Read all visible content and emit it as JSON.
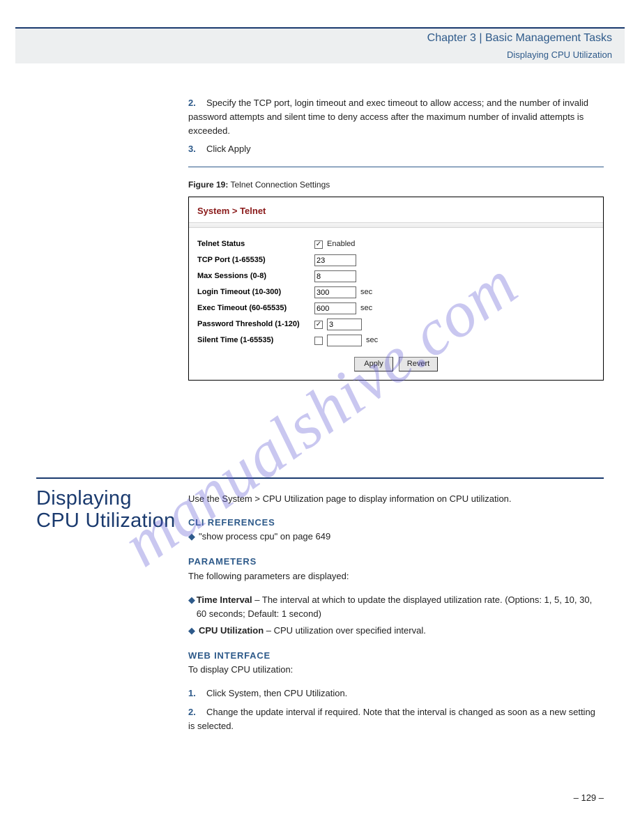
{
  "header": {
    "chapter": "Chapter 3  |  Basic Management Tasks",
    "section": "Displaying CPU Utilization"
  },
  "steps": {
    "s2": "Specify the TCP port, login timeout and exec timeout to allow access; and the number of invalid password attempts and silent time to deny access after the maximum number of invalid attempts is exceeded.",
    "s3": "Click Apply"
  },
  "figure": {
    "num": "Figure 19:",
    "caption": "Telnet Connection Settings"
  },
  "panel": {
    "title": "System > Telnet",
    "telnet_status_label": "Telnet Status",
    "telnet_enabled_label": "Enabled",
    "telnet_enabled_checked": "✓",
    "tcp_port_label": "TCP Port (1-65535)",
    "tcp_port_value": "23",
    "max_sessions_label": "Max Sessions (0-8)",
    "max_sessions_value": "8",
    "login_timeout_label": "Login Timeout (10-300)",
    "login_timeout_value": "300",
    "exec_timeout_label": "Exec Timeout (60-65535)",
    "exec_timeout_value": "600",
    "pw_thresh_label": "Password Threshold (1-120)",
    "pw_thresh_checked": "✓",
    "pw_thresh_value": "3",
    "silent_time_label": "Silent Time (1-65535)",
    "silent_time_checked": "",
    "silent_time_value": "",
    "sec": "sec",
    "apply": "Apply",
    "revert": "Revert"
  },
  "section2": {
    "heading": "Displaying CPU Utilization",
    "intro": "Use the System > CPU Utilization page to display information on CPU utilization.",
    "cmd_usage_head": "CLI REFERENCES",
    "cli_ref": "\"show process cpu\" on page 649",
    "params_head": "PARAMETERS",
    "params_intro": "The following parameters are displayed:",
    "p_time_label": "Time Interval",
    "p_time_desc": " – The interval at which to update the displayed utilization rate. (Options: 1, 5, 10, 30, 60 seconds; Default: 1 second)",
    "p_rate_label": "CPU Utilization",
    "p_rate_desc": " – CPU utilization over specified interval.",
    "web_head": "WEB INTERFACE",
    "web_intro": "To display CPU utilization:",
    "w1": "Click System, then CPU Utilization.",
    "w2": "Change the update interval if required. Note that the interval is changed as soon as a new setting is selected."
  },
  "page_number": "– 129 –",
  "watermark": "manualshive.com"
}
